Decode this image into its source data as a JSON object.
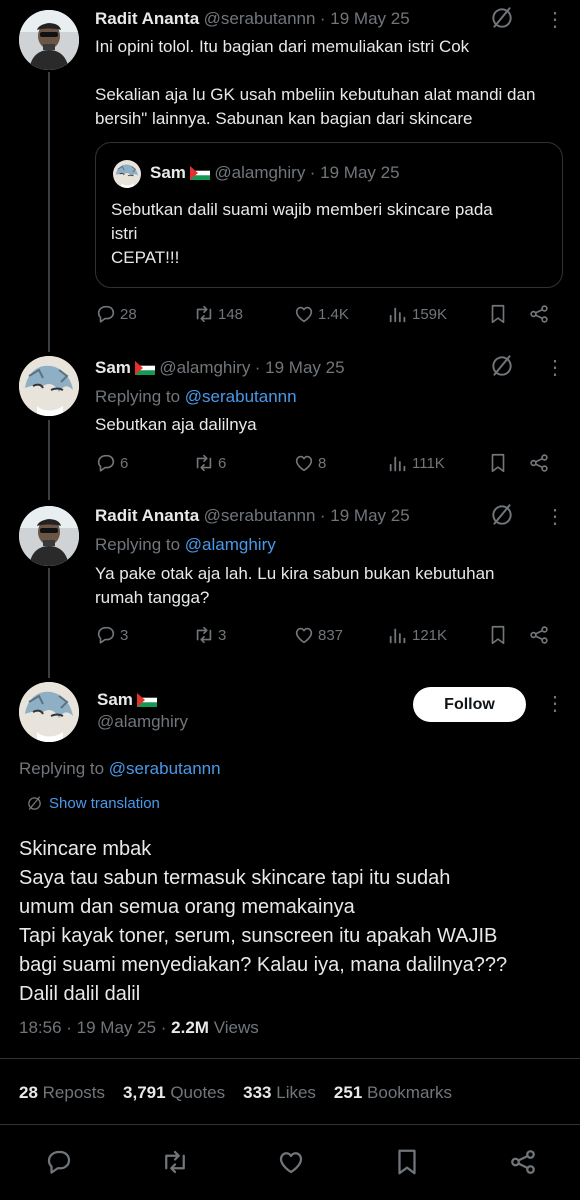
{
  "tweets": [
    {
      "name": "Radit Ananta",
      "handle": "@serabutannn",
      "date": "· 19 May 25",
      "text_lines": [
        "Ini opini tolol. Itu bagian dari memuliakan istri Cok",
        "",
        "Sekalian aja lu GK usah mbeliin kebutuhan alat mandi dan",
        "bersih\" lainnya. Sabunan kan bagian dari skincare"
      ],
      "quote": {
        "name": "Sam",
        "handle": "@alamghiry",
        "date": "· 19 May 25",
        "text_lines": [
          "Sebutkan dalil suami wajib memberi skincare pada",
          "istri",
          "CEPAT!!!"
        ]
      },
      "replies": "28",
      "reposts": "148",
      "likes": "1.4K",
      "views": "159K"
    },
    {
      "name": "Sam",
      "handle": "@alamghiry",
      "date": "· 19 May 25",
      "replying_prefix": "Replying to",
      "replying_to": "@serabutannn",
      "text_lines": [
        "Sebutkan aja dalilnya"
      ],
      "replies": "6",
      "reposts": "6",
      "likes": "8",
      "views": "111K"
    },
    {
      "name": "Radit Ananta",
      "handle": "@serabutannn",
      "date": "· 19 May 25",
      "replying_prefix": "Replying to",
      "replying_to": "@alamghiry",
      "text_lines": [
        "Ya pake otak aja lah. Lu kira sabun bukan kebutuhan",
        "rumah tangga?"
      ],
      "replies": "3",
      "reposts": "3",
      "likes": "837",
      "views": "121K"
    }
  ],
  "main": {
    "name": "Sam",
    "handle": "@alamghiry",
    "follow_label": "Follow",
    "replying_prefix": "Replying to",
    "replying_to": "@serabutannn",
    "show_translation": "Show translation",
    "text_lines": [
      "Skincare mbak",
      "Saya tau sabun termasuk skincare tapi itu sudah",
      "umum dan semua orang memakainya",
      "Tapi kayak toner, serum, sunscreen itu apakah WAJIB",
      "bagi suami menyediakan? Kalau iya, mana dalilnya???",
      "Dalil dalil dalil"
    ],
    "time": "18:56 · 19 May 25 ·",
    "views_count": "2.2M",
    "views_label": "Views",
    "stats": [
      {
        "count": "28",
        "label": "Reposts"
      },
      {
        "count": "3,791",
        "label": "Quotes"
      },
      {
        "count": "333",
        "label": "Likes"
      },
      {
        "count": "251",
        "label": "Bookmarks"
      }
    ]
  },
  "icons": {
    "reply": "reply-icon",
    "repost": "repost-icon",
    "like": "heart-icon",
    "views": "views-icon",
    "bookmark": "bookmark-icon",
    "share": "share-icon",
    "grok": "grok-icon",
    "more": "more-icon"
  },
  "colors": {
    "background": "#000000",
    "text": "#e7e9ea",
    "secondary": "#71767b",
    "link": "#4a99e9",
    "divider": "#2f3336"
  }
}
